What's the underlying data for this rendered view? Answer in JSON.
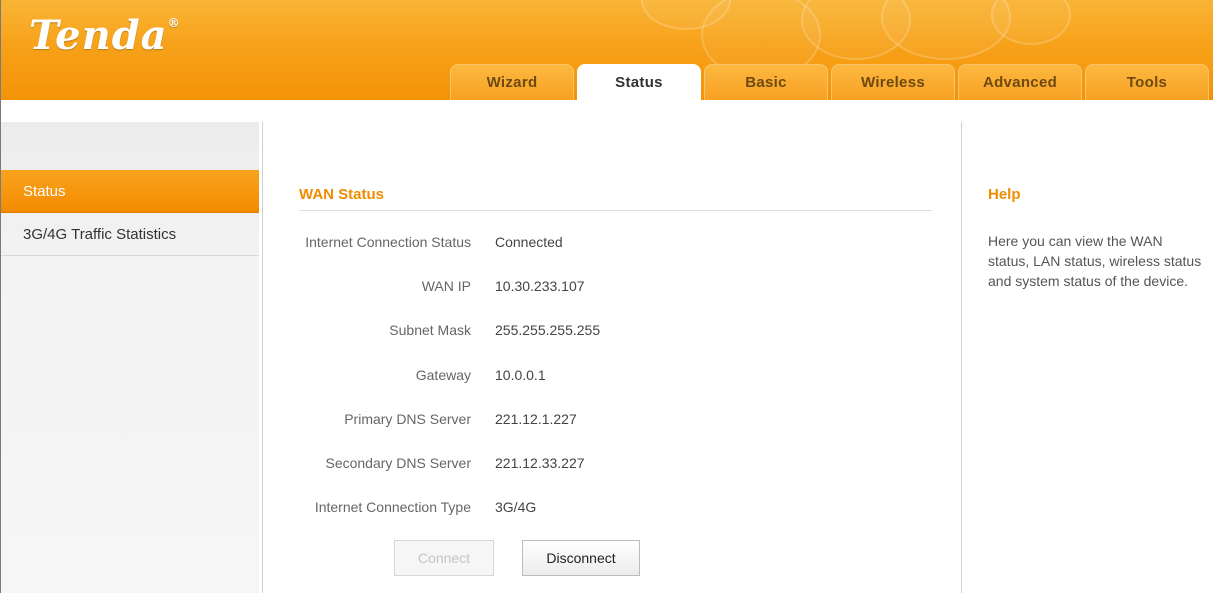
{
  "header": {
    "logo": "Tenda",
    "logo_mark": "®",
    "tabs": [
      {
        "label": "Wizard"
      },
      {
        "label": "Status"
      },
      {
        "label": "Basic"
      },
      {
        "label": "Wireless"
      },
      {
        "label": "Advanced"
      },
      {
        "label": "Tools"
      }
    ],
    "active_tab": "Status"
  },
  "sidebar": {
    "items": [
      {
        "label": "Status"
      },
      {
        "label": "3G/4G Traffic Statistics"
      }
    ],
    "active_item": "Status"
  },
  "wan_status": {
    "title": "WAN Status",
    "rows": [
      {
        "label": "Internet Connection Status",
        "value": "Connected"
      },
      {
        "label": "WAN IP",
        "value": "10.30.233.107"
      },
      {
        "label": "Subnet Mask",
        "value": "255.255.255.255"
      },
      {
        "label": "Gateway",
        "value": "10.0.0.1"
      },
      {
        "label": "Primary DNS Server",
        "value": "221.12.1.227"
      },
      {
        "label": "Secondary DNS Server",
        "value": "221.12.33.227"
      },
      {
        "label": "Internet Connection Type",
        "value": "3G/4G"
      }
    ],
    "connect_label": "Connect",
    "disconnect_label": "Disconnect"
  },
  "help": {
    "title": "Help",
    "text": "Here you can view the WAN status, LAN status, wireless status and system status of the device."
  },
  "colors": {
    "brand_orange": "#f7a21a",
    "accent_title": "#f08c00"
  }
}
